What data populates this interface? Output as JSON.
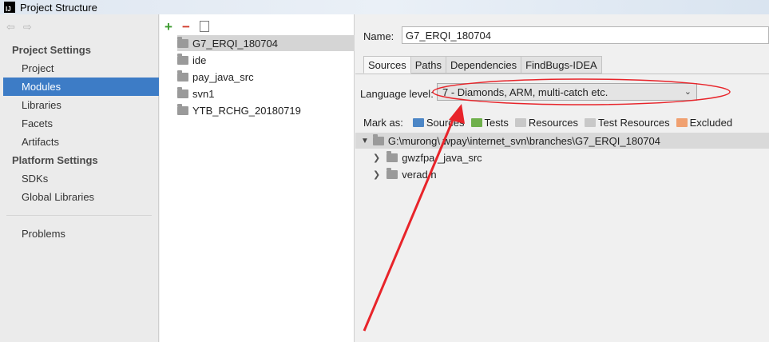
{
  "window": {
    "title": "Project Structure",
    "app_icon": "intellij-icon"
  },
  "nav": {
    "project_settings_heading": "Project Settings",
    "project_settings_items": [
      "Project",
      "Modules",
      "Libraries",
      "Facets",
      "Artifacts"
    ],
    "selected": "Modules",
    "platform_settings_heading": "Platform Settings",
    "platform_settings_items": [
      "SDKs",
      "Global Libraries"
    ],
    "problems": "Problems"
  },
  "modules": {
    "toolbar_icons": [
      "add-icon",
      "remove-icon",
      "copy-icon"
    ],
    "items": [
      "G7_ERQI_180704",
      "ide",
      "pay_java_src",
      "svn1",
      "YTB_RCHG_20180719"
    ],
    "selected": "G7_ERQI_180704"
  },
  "content": {
    "name_label": "Name:",
    "name_value": "G7_ERQI_180704",
    "tabs": [
      "Sources",
      "Paths",
      "Dependencies",
      "FindBugs-IDEA"
    ],
    "active_tab": "Sources",
    "language_label": "Language level:",
    "language_value": "7 - Diamonds, ARM, multi-catch etc.",
    "mark_as_label": "Mark as:",
    "mark_as": [
      {
        "label": "Sources",
        "color": "#4c86c6"
      },
      {
        "label": "Tests",
        "color": "#6fb04c"
      },
      {
        "label": "Resources",
        "color": "#c8c8c8"
      },
      {
        "label": "Test Resources",
        "color": "#c8c8c8"
      },
      {
        "label": "Excluded",
        "color": "#f0a070"
      }
    ],
    "tree_root": "G:\\murong\\ wpay\\internet_svn\\branches\\G7_ERQI_180704",
    "tree_children": [
      "gwzfpa _java_src",
      "verad n"
    ]
  },
  "annotation_color": "#e8242a"
}
